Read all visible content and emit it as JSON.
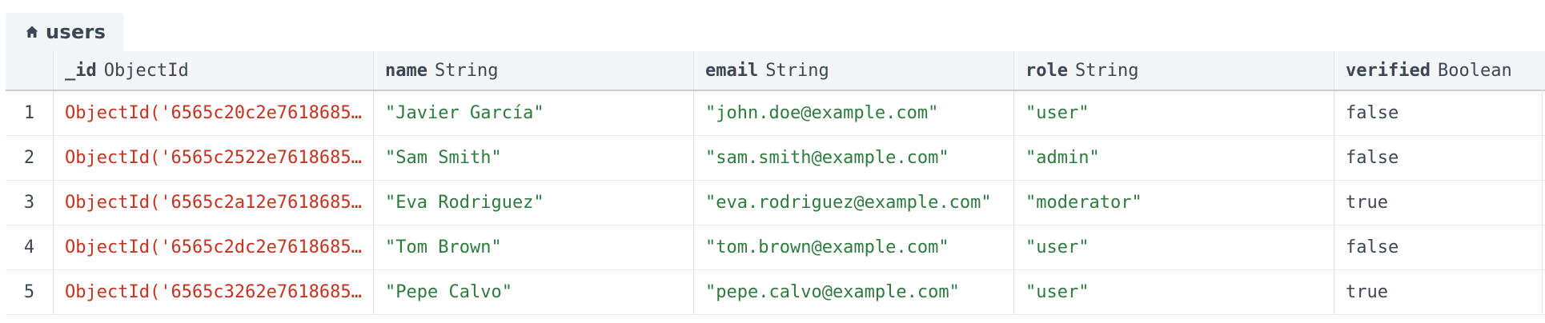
{
  "tab": {
    "icon": "home-icon",
    "label": "users"
  },
  "columns": [
    {
      "field": "_id",
      "type": "ObjectId"
    },
    {
      "field": "name",
      "type": "String"
    },
    {
      "field": "email",
      "type": "String"
    },
    {
      "field": "role",
      "type": "String"
    },
    {
      "field": "verified",
      "type": "Boolean"
    }
  ],
  "rows": [
    {
      "num": "1",
      "id": "ObjectId('6565c20c2e7618685…",
      "name": "\"Javier García\"",
      "email": "\"john.doe@example.com\"",
      "role": "\"user\"",
      "verified": "false"
    },
    {
      "num": "2",
      "id": "ObjectId('6565c2522e7618685…",
      "name": "\"Sam Smith\"",
      "email": "\"sam.smith@example.com\"",
      "role": "\"admin\"",
      "verified": "false"
    },
    {
      "num": "3",
      "id": "ObjectId('6565c2a12e7618685…",
      "name": "\"Eva Rodriguez\"",
      "email": "\"eva.rodriguez@example.com\"",
      "role": "\"moderator\"",
      "verified": "true"
    },
    {
      "num": "4",
      "id": "ObjectId('6565c2dc2e7618685…",
      "name": "\"Tom Brown\"",
      "email": "\"tom.brown@example.com\"",
      "role": "\"user\"",
      "verified": "false"
    },
    {
      "num": "5",
      "id": "ObjectId('6565c3262e7618685…",
      "name": "\"Pepe Calvo\"",
      "email": "\"pepe.calvo@example.com\"",
      "role": "\"user\"",
      "verified": "true"
    }
  ],
  "colors": {
    "objectid": "#c33321",
    "string": "#2f7a3e",
    "boolean": "#3d4753",
    "header_bg": "#f3f5f7"
  }
}
